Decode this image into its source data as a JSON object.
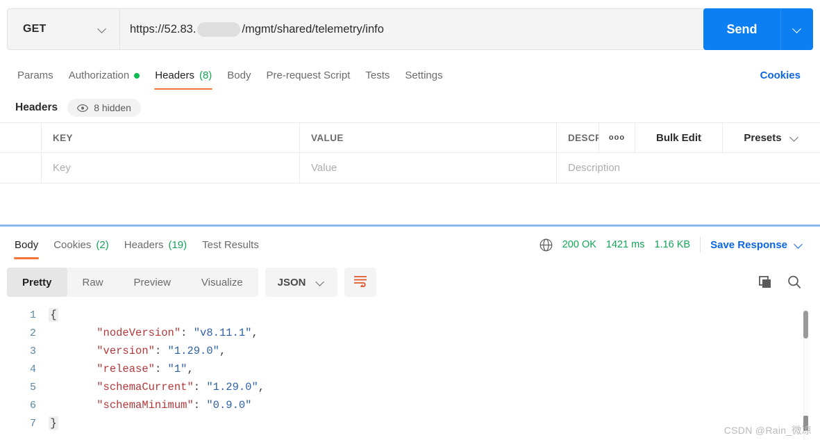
{
  "request": {
    "method": "GET",
    "url_prefix": "https://52.83.",
    "url_suffix": "/mgmt/shared/telemetry/info",
    "send_label": "Send",
    "tabs": [
      {
        "label": "Params",
        "count": "",
        "dot": false,
        "active": false
      },
      {
        "label": "Authorization",
        "count": "",
        "dot": true,
        "active": false
      },
      {
        "label": "Headers",
        "count": "(8)",
        "dot": false,
        "active": true
      },
      {
        "label": "Body",
        "count": "",
        "dot": false,
        "active": false
      },
      {
        "label": "Pre-request Script",
        "count": "",
        "dot": false,
        "active": false
      },
      {
        "label": "Tests",
        "count": "",
        "dot": false,
        "active": false
      },
      {
        "label": "Settings",
        "count": "",
        "dot": false,
        "active": false
      }
    ],
    "cookies_link": "Cookies"
  },
  "headers_section": {
    "title": "Headers",
    "hidden_pill": "8 hidden",
    "hidden_icon": "eye-icon",
    "columns": [
      "KEY",
      "VALUE",
      "DESCRIPTION"
    ],
    "placeholders": {
      "key": "Key",
      "value": "Value",
      "description": "Description"
    },
    "more_icon": "ooo",
    "bulk_edit": "Bulk Edit",
    "presets": "Presets"
  },
  "response": {
    "tabs": [
      {
        "label": "Body",
        "count": "",
        "active": true
      },
      {
        "label": "Cookies",
        "count": "(2)",
        "active": false
      },
      {
        "label": "Headers",
        "count": "(19)",
        "active": false
      },
      {
        "label": "Test Results",
        "count": "",
        "active": false
      }
    ],
    "globe_icon": "globe-icon",
    "status": "200 OK",
    "time": "1421 ms",
    "size": "1.16 KB",
    "save_response": "Save Response",
    "view_modes": [
      "Pretty",
      "Raw",
      "Preview",
      "Visualize"
    ],
    "selected_view": "Pretty",
    "format": "JSON",
    "wrap_icon": "word-wrap-icon",
    "copy_icon": "copy-icon",
    "search_icon": "search-icon"
  },
  "body_code": {
    "lines": [
      {
        "num": "1",
        "brace": "{",
        "text": ""
      },
      {
        "num": "2",
        "brace": "",
        "key": "\"nodeVersion\"",
        "value": "\"v8.11.1\"",
        "comma": ","
      },
      {
        "num": "3",
        "brace": "",
        "key": "\"version\"",
        "value": "\"1.29.0\"",
        "comma": ","
      },
      {
        "num": "4",
        "brace": "",
        "key": "\"release\"",
        "value": "\"1\"",
        "comma": ","
      },
      {
        "num": "5",
        "brace": "",
        "key": "\"schemaCurrent\"",
        "value": "\"1.29.0\"",
        "comma": ","
      },
      {
        "num": "6",
        "brace": "",
        "key": "\"schemaMinimum\"",
        "value": "\"0.9.0\"",
        "comma": ""
      },
      {
        "num": "7",
        "brace": "}",
        "text": ""
      }
    ]
  },
  "watermark": "CSDN @Rain_微凉",
  "colors": {
    "accent_blue": "#0c7ff2",
    "link_blue": "#0c66e4",
    "active_orange": "#f2743a",
    "success_green": "#13a456",
    "dot_green": "#0cbb52",
    "json_key": "#b5373a",
    "json_string": "#2c5fa8",
    "line_number": "#5986a6"
  }
}
